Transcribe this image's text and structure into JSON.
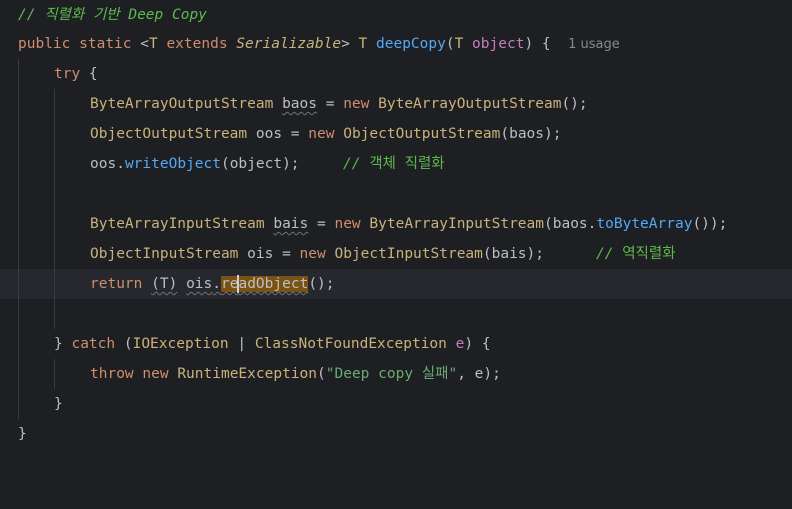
{
  "editor": {
    "colors": {
      "background": "#1e1f22",
      "keyword": "#cf8e6d",
      "type": "#c9b27c",
      "method": "#56a8f5",
      "comment": "#5fb950",
      "string": "#6aab73",
      "selection": "#7a5312"
    },
    "header_comment": "// 직렬화 기반 Deep Copy",
    "signature": {
      "kw_public": "public",
      "kw_static": "static",
      "lt": "<",
      "type_param": "T",
      "kw_extends": "extends",
      "bound": "Serializable",
      "gt": ">",
      "return_type": "T",
      "method": "deepCopy",
      "open_paren": "(",
      "param_type": "T",
      "param_name": "object",
      "close": ") {",
      "usage_hint": "1 usage"
    },
    "try_kw": "try",
    "try_brace": " {",
    "line_baos": {
      "type": "ByteArrayOutputStream",
      "var": "baos",
      "assign": " = ",
      "kw_new": "new",
      "ctor": "ByteArrayOutputStream",
      "rest": "();"
    },
    "line_oos": {
      "type": "ObjectOutputStream",
      "var": "oos",
      "assign": " = ",
      "kw_new": "new",
      "ctor": "ObjectOutputStream",
      "rest": "(baos);"
    },
    "line_write": {
      "obj": "oos",
      "dot": ".",
      "method": "writeObject",
      "args": "(object);",
      "comment_slash": "// ",
      "comment_text": "객체 직렬화"
    },
    "line_bais": {
      "type": "ByteArrayInputStream",
      "var": "bais",
      "assign": " = ",
      "kw_new": "new",
      "ctor": "ByteArrayInputStream",
      "arg_open": "(baos.",
      "arg_method": "toByteArray",
      "rest": "());"
    },
    "line_ois": {
      "type": "ObjectInputStream",
      "var": "ois",
      "assign": " = ",
      "kw_new": "new",
      "ctor": "ObjectInputStream",
      "rest": "(bais);",
      "comment_slash": "// ",
      "comment_text": "역직렬화"
    },
    "line_return": {
      "kw_return": "return",
      "cast": "(T)",
      "obj": "ois",
      "dot": ".",
      "method_pre": "re",
      "method_post": "adObject",
      "rest": "();"
    },
    "line_catch": {
      "brace": "}",
      "kw_catch": "catch",
      "open": "(",
      "ex1": "IOException",
      "pipe": " | ",
      "ex2": "ClassNotFoundException",
      "var": "e",
      "close": ") {"
    },
    "line_throw": {
      "kw_throw": "throw",
      "kw_new": "new",
      "ctor": "RuntimeException",
      "open": "(",
      "str": "\"Deep copy 실패\"",
      "rest": ", e);"
    },
    "close_try": "}",
    "close_method": "}"
  }
}
